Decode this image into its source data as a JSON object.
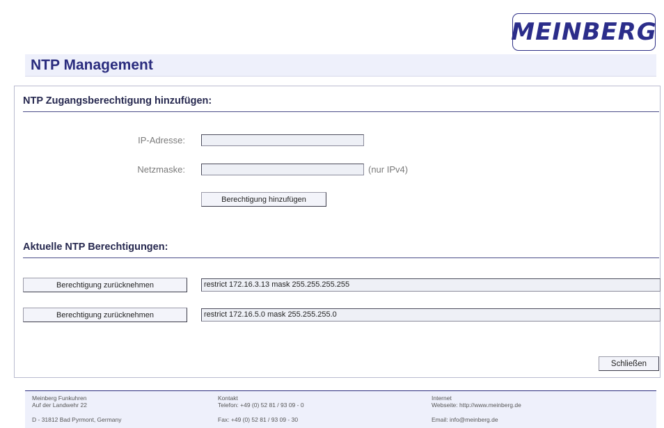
{
  "logo": {
    "text": "MEINBERG"
  },
  "page_title": "NTP Management",
  "add_section": {
    "heading": "NTP Zugangsberechtigung hinzufügen:",
    "ip_label": "IP-Adresse:",
    "ip_value": "",
    "mask_label": "Netzmaske:",
    "mask_value": "",
    "mask_hint": "(nur IPv4)",
    "add_button": "Berechtigung hinzufügen"
  },
  "current_section": {
    "heading": "Aktuelle NTP Berechtigungen:",
    "rules": [
      {
        "revoke_label": "Berechtigung zurücknehmen",
        "value": "restrict 172.16.3.13 mask 255.255.255.255"
      },
      {
        "revoke_label": "Berechtigung zurücknehmen",
        "value": "restrict 172.16.5.0 mask 255.255.255.0"
      }
    ]
  },
  "close_button": "Schließen",
  "footer": {
    "company": {
      "name": "Meinberg Funkuhren",
      "street": "Auf der Landwehr 22",
      "city": "D - 31812 Bad Pyrmont, Germany"
    },
    "contact": {
      "heading": "Kontakt",
      "phone": "Telefon: +49 (0) 52 81 / 93 09 - 0",
      "fax": "Fax: +49 (0) 52 81 / 93 09 - 30"
    },
    "internet": {
      "heading": "Internet",
      "website": "Webseite: http://www.meinberg.de",
      "email": "Email: info@meinberg.de"
    }
  }
}
